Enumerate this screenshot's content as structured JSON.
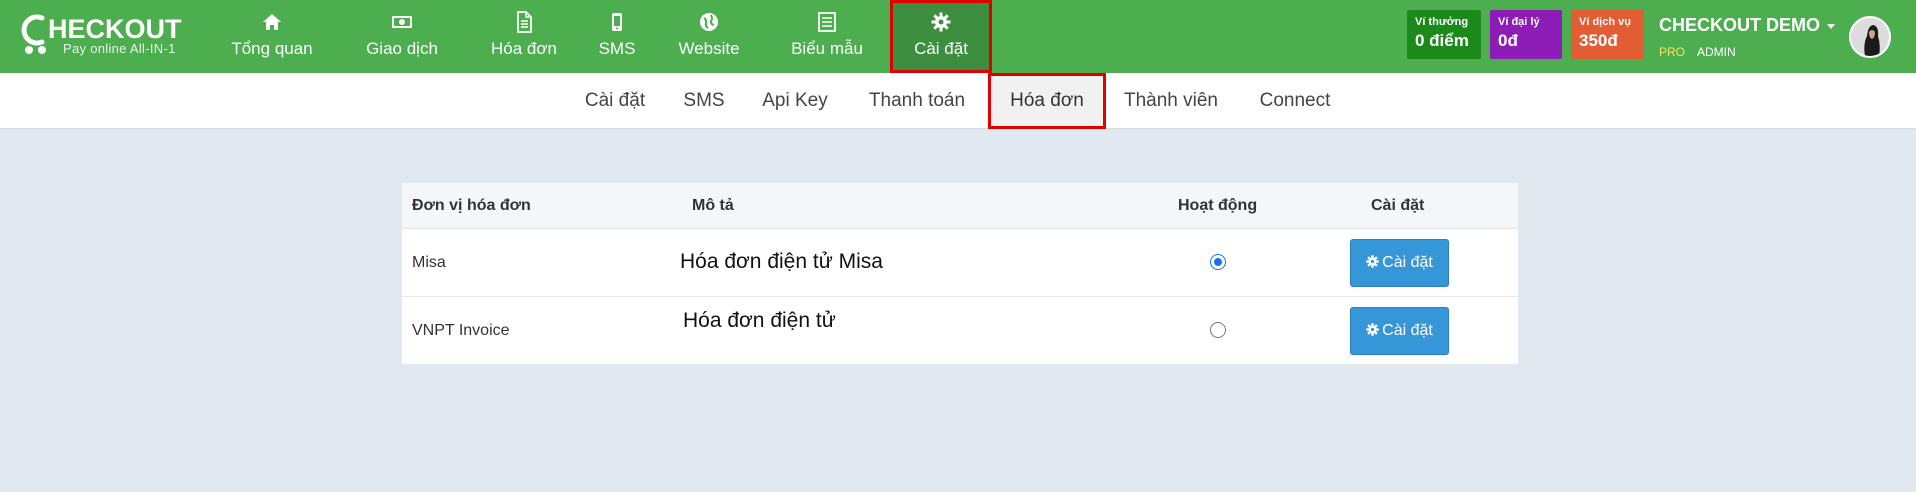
{
  "brand": {
    "title": "HECKOUT",
    "tagline": "Pay online All-IN-1",
    "color": "#4cae4f"
  },
  "nav": {
    "items": [
      {
        "label": "Tổng quan",
        "icon": "home-icon"
      },
      {
        "label": "Giao dịch",
        "icon": "money-icon"
      },
      {
        "label": "Hóa đơn",
        "icon": "document-icon"
      },
      {
        "label": "SMS",
        "icon": "phone-icon"
      },
      {
        "label": "Website",
        "icon": "globe-icon"
      },
      {
        "label": "Biểu mẫu",
        "icon": "form-icon"
      },
      {
        "label": "Cài đặt",
        "icon": "gear-icon",
        "active": true
      }
    ]
  },
  "wallets": [
    {
      "label": "Ví thưởng",
      "value": "0 điểm",
      "color": "#1b8a1b"
    },
    {
      "label": "Ví đại lý",
      "value": "0đ",
      "color": "#8e1db8"
    },
    {
      "label": "Ví dịch vụ",
      "value": "350đ",
      "color": "#e35d34"
    }
  ],
  "account": {
    "name": "CHECKOUT DEMO",
    "plan": "PRO",
    "role": "ADMIN"
  },
  "subnav": {
    "items": [
      {
        "label": "Cài đặt"
      },
      {
        "label": "SMS"
      },
      {
        "label": "Api Key"
      },
      {
        "label": "Thanh toán"
      },
      {
        "label": "Hóa đơn",
        "active": true
      },
      {
        "label": "Thành viên"
      },
      {
        "label": "Connect"
      }
    ]
  },
  "table": {
    "headers": {
      "unit": "Đơn vị hóa đơn",
      "desc": "Mô tả",
      "active": "Hoạt động",
      "settings": "Cài đặt"
    },
    "rows": [
      {
        "unit": "Misa",
        "desc": "Hóa đơn điện tử Misa",
        "active": true,
        "button": "Cài đặt"
      },
      {
        "unit": "VNPT Invoice",
        "desc": "Hóa đơn điện tử",
        "active": false,
        "button": "Cài đặt"
      }
    ]
  }
}
